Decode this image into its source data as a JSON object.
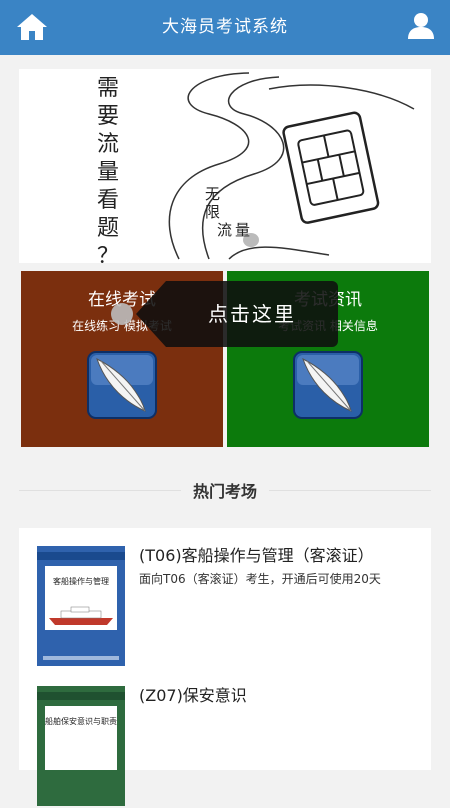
{
  "header": {
    "title": "大海员考试系统",
    "left_icon": "home-icon",
    "right_icon": "user-icon"
  },
  "banner": {
    "vertical_chars": [
      "需",
      "要",
      "流",
      "量",
      "看",
      "题",
      "？"
    ],
    "handwritten_chars": [
      "无",
      "限",
      "流",
      "量"
    ]
  },
  "tiles": [
    {
      "title": "在线考试",
      "subtitle": "在线练习 模拟考试",
      "color": "#7b2f0e",
      "icon": "feather-icon"
    },
    {
      "title": "考试资讯",
      "subtitle": "考试资讯 相关信息",
      "color": "#0c7a0c",
      "icon": "feather-icon"
    }
  ],
  "tooltip": {
    "text": "点击这里"
  },
  "section": {
    "title": "热门考场"
  },
  "courses": [
    {
      "name": "(T06)客船操作与管理（客滚证）",
      "desc": "面向T06（客滚证）考生，开通后可使用20天",
      "cover_title": "客船操作与管理"
    },
    {
      "name": "(Z07)保安意识",
      "desc": "",
      "cover_title": "船舶保安意识与职责"
    }
  ]
}
